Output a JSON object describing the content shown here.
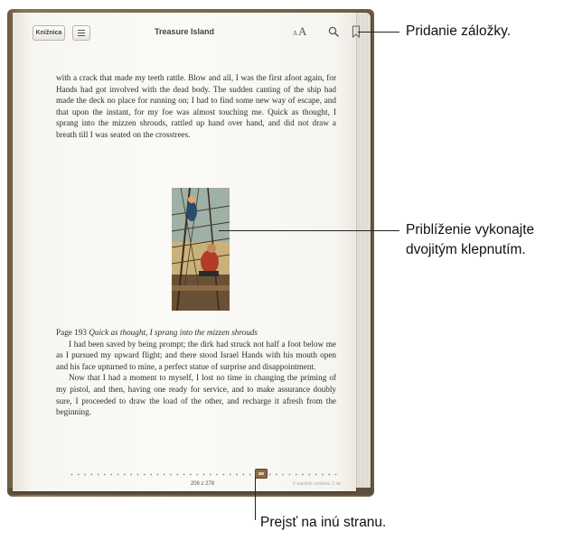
{
  "book": {
    "library_label": "Knižnica",
    "title": "Treasure Island",
    "font_button_small": "A",
    "font_button_large": "A"
  },
  "page": {
    "paragraph_top": "with a crack that made my teeth rattle. Blow and all, I was the first afoot again, for Hands had got involved with the dead body. The sudden canting of the ship had made the deck no place for running on; I had to find some new way of escape, and that upon the instant, for my foe was almost touching me. Quick as thought, I sprang into the mizzen shrouds, rattled up hand over hand, and did not draw a breath till I was seated on the crosstrees.",
    "caption_number": "Page 193 ",
    "caption_text": "Quick as thought, I sprang into the mizzen shrouds",
    "paragraph_2": "I had been saved by being prompt; the dirk had struck not half a foot below me as I pursued my upward flight; and there stood Israel Hands with his mouth open and his face upturned to mine, a perfect statue of surprise and disappointment.",
    "paragraph_3": "Now that I had a moment to myself, I lost no time in changing the priming of my pistol, and then, having one ready for service, and to make assurance doubly sure, I proceeded to draw the load of the other, and recharge it afresh from the beginning."
  },
  "footer": {
    "page_count": "206 z 278",
    "chapter_remaining": "V kapitole zostáva: 2 str."
  },
  "callouts": {
    "bookmark": "Pridanie záložky.",
    "zoom_line1": "Priblíženie vykonajte",
    "zoom_line2": "dvojitým klepnutím.",
    "navigate": "Prejsť na inú stranu."
  }
}
